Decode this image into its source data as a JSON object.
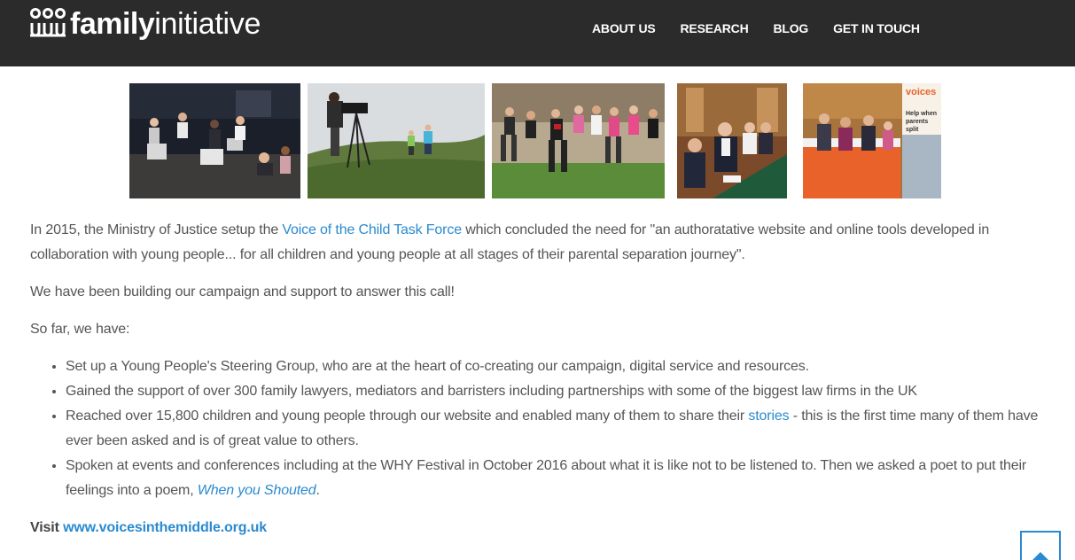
{
  "header": {
    "logo_bold": "family",
    "logo_light": "initiative",
    "nav": [
      "ABOUT US",
      "RESEARCH",
      "BLOG",
      "GET IN TOUCH"
    ]
  },
  "gallery": {
    "photos": [
      "drama-workshop-photo",
      "filming-on-hill-photo",
      "group-running-photo",
      "meeting-table-photo",
      "event-stall-photo"
    ],
    "stall_banner_heading": "voices",
    "stall_banner_text": "Help when parents split"
  },
  "intro": {
    "text_before": "In 2015, the Ministry of Justice setup the ",
    "link": "Voice of the Child Task Force",
    "text_after": " which concluded the need for \"an authoratative website and online tools developed in collaboration with young people... for all children and young people at all stages of their parental separation journey\"."
  },
  "paragraph2": "We have been building our campaign and support to answer this call!",
  "paragraph3": "So far, we have:",
  "achievements": {
    "item1": "Set up a Young People's Steering Group, who are at the heart of co-creating our campaign, digital service and resources.",
    "item2": "Gained the support of over 300 family lawyers, mediators and barristers including partnerships with some of the biggest law firms in the UK",
    "item3_before": "Reached over 15,800 children and young people through our website and enabled many of them to share their ",
    "item3_link": "stories",
    "item3_after": " - this is the first time many of them have ever been asked and is of great value to others.",
    "item4_before": "Spoken at events and conferences including at the WHY Festival in October 2016 about what it is like not to be listened to. Then we asked a poet to put their feelings into a poem, ",
    "item4_link": "When you Shouted",
    "item4_after": "."
  },
  "visit": {
    "label": "Visit",
    "link": "www.voicesinthemiddle.org.uk"
  },
  "back_to_top_icon": "up-arrow-icon",
  "colors": {
    "header_bg": "#2b2b2b",
    "link": "#2a8ad0",
    "body_text": "#555555"
  }
}
